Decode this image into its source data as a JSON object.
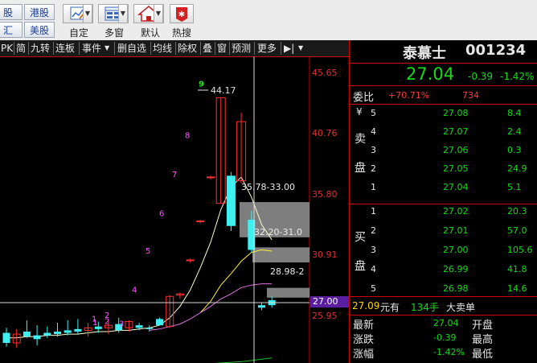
{
  "toolbar": {
    "market_buttons": [
      "股",
      "港股",
      "汇",
      "美股"
    ],
    "tools": [
      {
        "label": "自定",
        "icon": "chart-edit-icon"
      },
      {
        "label": "多窗",
        "icon": "multi-window-icon"
      },
      {
        "label": "默认",
        "icon": "home-icon"
      },
      {
        "label": "热搜",
        "icon": "hot-search-icon"
      }
    ]
  },
  "chart_tabs": [
    "PK",
    "简",
    "九转",
    "连板",
    "事件",
    "删自选",
    "均线",
    "除权",
    "叠",
    "窗",
    "预测",
    "更多"
  ],
  "chart_icons": [
    "line-draw-icon",
    "undo-icon",
    "trash-icon",
    "lock-icon",
    "hand-icon",
    "zoom-out-icon",
    "zoom-in-icon",
    "settings-icon"
  ],
  "price_axis": {
    "ticks": [
      "45.65",
      "40.76",
      "35.80",
      "30.91",
      "25.95"
    ],
    "current": "27.00"
  },
  "chart_annotations": {
    "high": "44.17",
    "zone1": "35.78-33.00",
    "zone2": "32.20-31.0",
    "zone3": "28.98-2",
    "counts": [
      "1",
      "2",
      "1",
      "2",
      "3",
      "4",
      "5",
      "6",
      "7",
      "8",
      "9"
    ]
  },
  "chart_data": {
    "type": "candlestick",
    "ylim": [
      23.0,
      46.5
    ],
    "candles": [
      {
        "o": 25.4,
        "h": 25.8,
        "l": 24.3,
        "c": 24.6
      },
      {
        "o": 24.6,
        "h": 25.7,
        "l": 24.2,
        "c": 25.3
      },
      {
        "o": 25.5,
        "h": 26.4,
        "l": 25.0,
        "c": 25.1
      },
      {
        "o": 25.2,
        "h": 26.0,
        "l": 24.4,
        "c": 24.9
      },
      {
        "o": 25.4,
        "h": 25.9,
        "l": 25.0,
        "c": 25.2
      },
      {
        "o": 25.5,
        "h": 26.2,
        "l": 25.1,
        "c": 25.3
      },
      {
        "o": 25.6,
        "h": 26.4,
        "l": 25.2,
        "c": 25.4
      },
      {
        "o": 25.7,
        "h": 26.5,
        "l": 25.3,
        "c": 25.5
      },
      {
        "o": 25.6,
        "h": 26.2,
        "l": 25.1,
        "c": 25.8
      },
      {
        "o": 25.9,
        "h": 26.3,
        "l": 25.4,
        "c": 25.7
      },
      {
        "o": 25.8,
        "h": 26.4,
        "l": 25.3,
        "c": 26.0
      },
      {
        "o": 26.1,
        "h": 26.6,
        "l": 25.4,
        "c": 25.6
      },
      {
        "o": 25.8,
        "h": 26.4,
        "l": 25.5,
        "c": 26.3
      },
      {
        "o": 26.0,
        "h": 26.2,
        "l": 25.6,
        "c": 25.8
      },
      {
        "o": 25.8,
        "h": 26.0,
        "l": 25.5,
        "c": 25.7
      },
      {
        "o": 26.5,
        "h": 26.6,
        "l": 26.0,
        "c": 26.0
      },
      {
        "o": 25.9,
        "h": 28.4,
        "l": 25.8,
        "c": 28.3
      },
      {
        "o": 28.4,
        "h": 28.6,
        "l": 28.1,
        "c": 28.5
      },
      {
        "o": 31.2,
        "h": 31.3,
        "l": 31.0,
        "c": 31.2
      },
      {
        "o": 34.3,
        "h": 34.4,
        "l": 34.1,
        "c": 34.3
      },
      {
        "o": 37.8,
        "h": 37.9,
        "l": 37.6,
        "c": 37.8
      },
      {
        "o": 35.7,
        "h": 44.1,
        "l": 35.7,
        "c": 44.1
      },
      {
        "o": 37.9,
        "h": 38.2,
        "l": 33.5,
        "c": 33.9
      },
      {
        "o": 37.5,
        "h": 42.9,
        "l": 37.3,
        "c": 42.2
      },
      {
        "o": 34.4,
        "h": 35.1,
        "l": 31.8,
        "c": 32.0
      },
      {
        "o": 27.6,
        "h": 27.8,
        "l": 27.2,
        "c": 27.4
      },
      {
        "o": 28.0,
        "h": 28.3,
        "l": 27.4,
        "c": 27.6
      }
    ],
    "ma": [
      {
        "name": "",
        "color": "#ffffd0",
        "values": [
          25.0,
          25.0,
          25.1,
          25.1,
          25.2,
          25.2,
          25.3,
          25.3,
          25.4,
          25.5,
          25.5,
          25.6,
          25.6,
          25.7,
          25.8,
          26.0,
          26.6,
          27.5,
          28.8,
          30.6,
          32.6,
          35.2,
          37.0,
          37.8,
          36.2,
          34.0,
          32.8
        ]
      },
      {
        "name": "",
        "color": "#ffee33",
        "values": [
          null,
          null,
          null,
          null,
          null,
          null,
          null,
          null,
          null,
          null,
          null,
          null,
          null,
          null,
          null,
          null,
          null,
          null,
          null,
          27.0,
          27.9,
          29.2,
          30.1,
          31.1,
          31.8,
          32.0,
          31.9
        ]
      },
      {
        "name": "",
        "color": "#e070e0",
        "values": [
          null,
          null,
          null,
          null,
          null,
          null,
          null,
          null,
          null,
          null,
          null,
          null,
          null,
          null,
          25.6,
          25.7,
          25.9,
          26.1,
          26.5,
          27.0,
          27.5,
          28.1,
          28.5,
          29.0,
          29.2,
          29.3,
          29.3
        ]
      },
      {
        "name": "",
        "color": "#22c022",
        "values": [
          null,
          null,
          null,
          null,
          null,
          null,
          null,
          null,
          null,
          null,
          null,
          null,
          null,
          null,
          null,
          null,
          null,
          null,
          null,
          null,
          null,
          null,
          null,
          23.1,
          23.2,
          23.3,
          23.4
        ]
      }
    ]
  },
  "quote": {
    "name": "泰慕士",
    "code": "001234",
    "price": "27.04",
    "change": "-0.39",
    "pct": "-1.42%",
    "weibi_label": "委比",
    "weibi": "+70.71%",
    "weicha": "734",
    "sell_label": [
      "卖",
      "盘"
    ],
    "buy_label": [
      "买",
      "盘"
    ],
    "currency": "¥",
    "sell": [
      {
        "lvl": "5",
        "price": "27.08",
        "vol": "8.4"
      },
      {
        "lvl": "4",
        "price": "27.07",
        "vol": "2.4"
      },
      {
        "lvl": "3",
        "price": "27.06",
        "vol": "0.3"
      },
      {
        "lvl": "2",
        "price": "27.05",
        "vol": "24.9"
      },
      {
        "lvl": "1",
        "price": "27.04",
        "vol": "5.1"
      }
    ],
    "buy": [
      {
        "lvl": "1",
        "price": "27.02",
        "vol": "20.3"
      },
      {
        "lvl": "2",
        "price": "27.01",
        "vol": "57.0"
      },
      {
        "lvl": "3",
        "price": "27.00",
        "vol": "105.6"
      },
      {
        "lvl": "4",
        "price": "26.99",
        "vol": "41.8"
      },
      {
        "lvl": "5",
        "price": "26.98",
        "vol": "14.6"
      }
    ],
    "big_order": {
      "price": "27.09",
      "unit1": "元有",
      "qty": "134手",
      "label": "大卖单"
    },
    "stats": [
      {
        "k": "最新",
        "v": "27.04",
        "k2": "开盘"
      },
      {
        "k": "涨跌",
        "v": "-0.39",
        "k2": "最高"
      },
      {
        "k": "涨幅",
        "v": "-1.42%",
        "k2": "最低"
      }
    ]
  }
}
